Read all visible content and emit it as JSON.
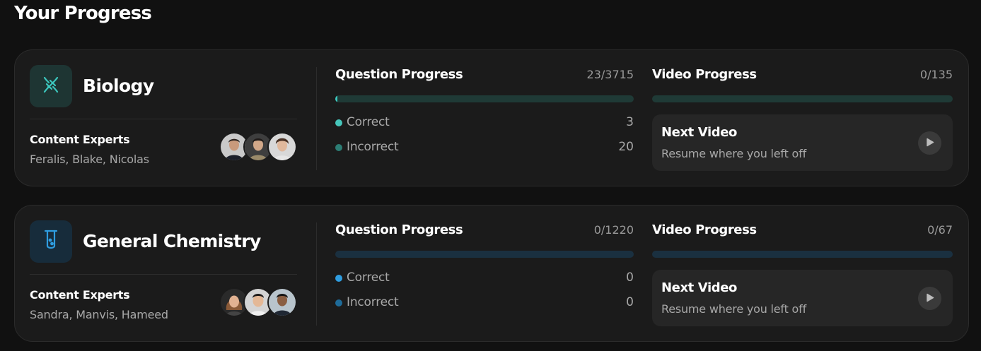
{
  "page": {
    "title": "Your Progress"
  },
  "subjects": [
    {
      "name": "Biology",
      "icon": "dna-icon",
      "icon_bg": "#1e3533",
      "accent": "#3cc6bd",
      "experts_label": "Content Experts",
      "experts_names": "Feralis, Blake, Nicolas",
      "question_progress": {
        "title": "Question Progress",
        "count": "23/3715",
        "fraction": 0.0062,
        "track_color": "#1f3a36",
        "correct_label": "Correct",
        "correct_value": "3",
        "correct_color": "#46c6bb",
        "incorrect_label": "Incorrect",
        "incorrect_value": "20",
        "incorrect_color": "#2c7d74"
      },
      "video_progress": {
        "title": "Video Progress",
        "count": "0/135",
        "fraction": 0,
        "track_color": "#1f3a36"
      },
      "next_video": {
        "title": "Next Video",
        "subtitle": "Resume where you left off"
      }
    },
    {
      "name": "General Chemistry",
      "icon": "test-tube-icon",
      "icon_bg": "#172c3b",
      "accent": "#2f9de0",
      "experts_label": "Content Experts",
      "experts_names": "Sandra, Manvis, Hameed",
      "question_progress": {
        "title": "Question Progress",
        "count": "0/1220",
        "fraction": 0,
        "track_color": "#1a3040",
        "correct_label": "Correct",
        "correct_value": "0",
        "correct_color": "#2f9de0",
        "incorrect_label": "Incorrect",
        "incorrect_value": "0",
        "incorrect_color": "#1e6b99"
      },
      "video_progress": {
        "title": "Video Progress",
        "count": "0/67",
        "fraction": 0,
        "track_color": "#1a3040"
      },
      "next_video": {
        "title": "Next Video",
        "subtitle": "Resume where you left off"
      }
    }
  ]
}
